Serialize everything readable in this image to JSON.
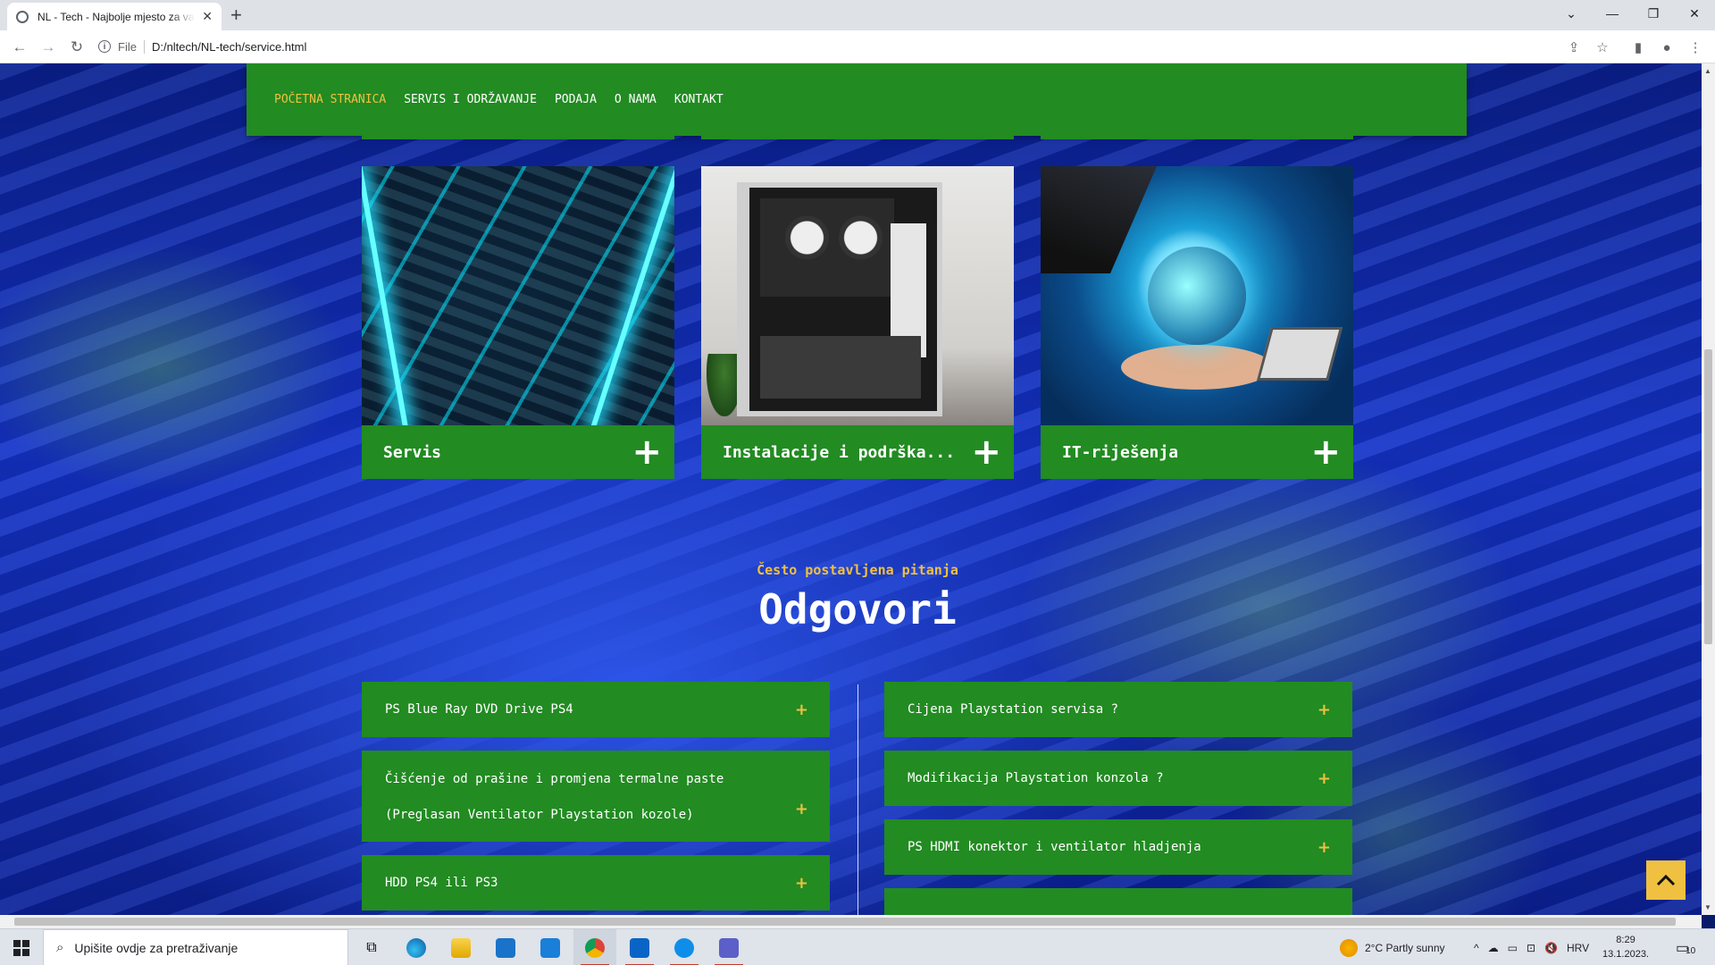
{
  "browser": {
    "tab_title": "NL - Tech - Najbolje mjesto za va",
    "address_scheme": "File",
    "address_url": "D:/nltech/NL-tech/service.html"
  },
  "nav": {
    "items": [
      "POČETNA STRANICA",
      "SERVIS I ODRŽAVANJE",
      "PODAJA",
      "O NAMA",
      "KONTAKT"
    ]
  },
  "cards": [
    {
      "title": "Servis"
    },
    {
      "title": "Instalacije i podrška..."
    },
    {
      "title": "IT-riješenja"
    }
  ],
  "faq": {
    "pretitle": "Često postavljena pitanja",
    "title": "Odgovori",
    "left": [
      {
        "lines": [
          "PS Blue Ray DVD Drive PS4"
        ]
      },
      {
        "lines": [
          "Čišćenje od prašine i promjena termalne paste",
          "(Preglasan Ventilator Playstation kozole)"
        ]
      },
      {
        "lines": [
          "HDD PS4 ili PS3"
        ]
      }
    ],
    "right": [
      {
        "lines": [
          "Cijena Playstation servisa ?"
        ]
      },
      {
        "lines": [
          "Modifikacija Playstation konzola ?"
        ]
      },
      {
        "lines": [
          "PS HDMI konektor i ventilator hladjenja"
        ]
      }
    ],
    "plus_symbol": "+"
  },
  "taskbar": {
    "search_placeholder": "Upišite ovdje za pretraživanje",
    "weather": "2°C  Partly sunny",
    "language": "HRV",
    "time": "8:29",
    "date": "13.1.2023.",
    "notifications": "10"
  },
  "colors": {
    "brand_green": "#228b22",
    "accent_yellow": "#f0c040"
  }
}
